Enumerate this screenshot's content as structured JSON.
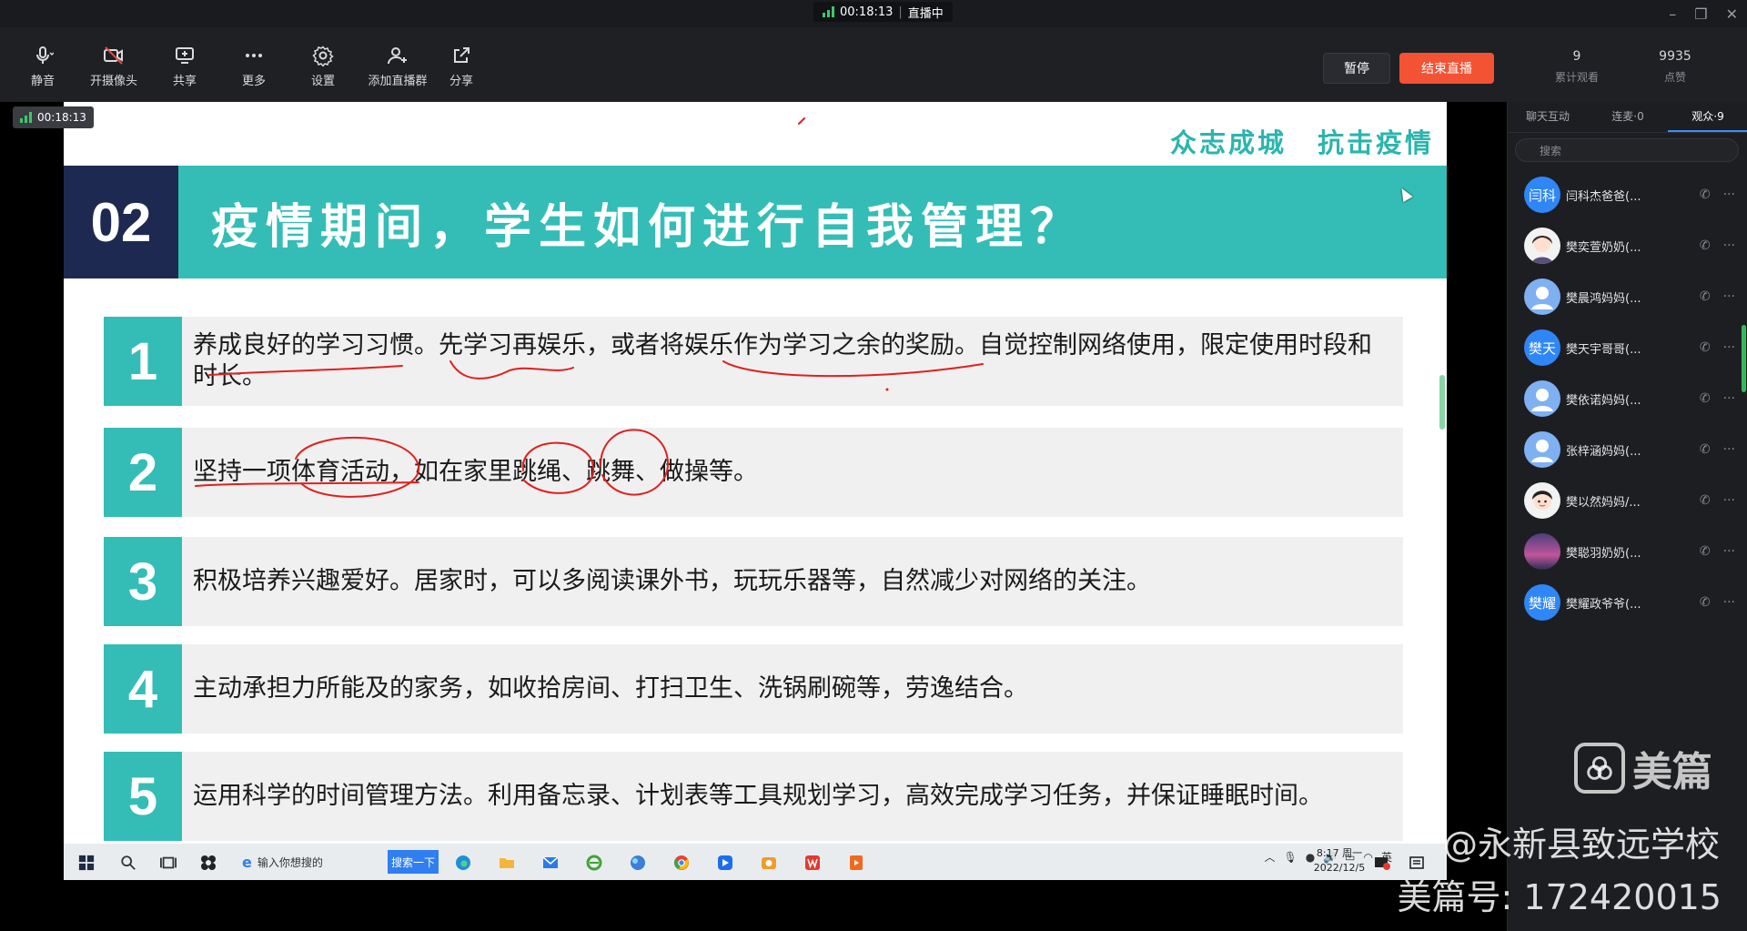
{
  "status": {
    "timer": "00:18:13",
    "live_label": "直播中"
  },
  "toolbar": {
    "mute": "静音",
    "camera": "开摄像头",
    "share": "共享",
    "more": "更多",
    "settings": "设置",
    "add_group": "添加直播群",
    "share_link": "分享",
    "pause": "暂停",
    "end_live": "结束直播",
    "cumulative_viewers": "9",
    "cumulative_viewers_label": "累计观看",
    "likes": "9935",
    "likes_label": "点赞"
  },
  "stage": {
    "timer": "00:18:13"
  },
  "slide": {
    "slogan_left": "众志成城",
    "slogan_right": "抗击疫情",
    "section_number": "02",
    "section_title": "疫情期间，学生如何进行自我管理？",
    "items": [
      {
        "n": "1",
        "text": "养成良好的学习习惯。先学习再娱乐，或者将娱乐作为学习之余的奖励。自觉控制网络使用，限定使用时段和时长。"
      },
      {
        "n": "2",
        "text": "坚持一项体育活动，如在家里跳绳、跳舞、做操等。"
      },
      {
        "n": "3",
        "text": "积极培养兴趣爱好。居家时，可以多阅读课外书，玩玩乐器等，自然减少对网络的关注。"
      },
      {
        "n": "4",
        "text": "主动承担力所能及的家务，如收拾房间、打扫卫生、洗锅刷碗等，劳逸结合。"
      },
      {
        "n": "5",
        "text": "运用科学的时间管理方法。利用备忘录、计划表等工具规划学习，高效完成学习任务，并保证睡眠时间。"
      }
    ]
  },
  "taskbar": {
    "search_placeholder": "输入你想搜的",
    "search_button": "搜索一下",
    "clock_time": "8:17 周一",
    "clock_date": "2022/12/5"
  },
  "panel": {
    "tabs": [
      "聊天互动",
      "连麦·0",
      "观众·9"
    ],
    "search_placeholder": "搜索",
    "users": [
      {
        "avatar": "闫科",
        "name": "闫科杰爸爸(...",
        "style": "blue"
      },
      {
        "avatar": "",
        "name": "樊奕萱奶奶(...",
        "style": "face"
      },
      {
        "avatar": "",
        "name": "樊晨鸿妈妈(...",
        "style": "light"
      },
      {
        "avatar": "樊天",
        "name": "樊天宇哥哥(...",
        "style": "blue"
      },
      {
        "avatar": "",
        "name": "樊依诺妈妈(...",
        "style": "light"
      },
      {
        "avatar": "",
        "name": "张梓涵妈妈(...",
        "style": "light"
      },
      {
        "avatar": "",
        "name": "樊以然妈妈/...",
        "style": "face"
      },
      {
        "avatar": "",
        "name": "樊聪羽奶奶(...",
        "style": "city"
      },
      {
        "avatar": "樊耀",
        "name": "樊耀政爷爷(...",
        "style": "blue"
      }
    ]
  },
  "watermark": {
    "brand": "美篇",
    "account": "@永新县致远学校",
    "id_line": "美篇号: 172420015"
  },
  "colors": {
    "teal": "#34bdb6",
    "navy": "#1d2951",
    "end_button": "#f35233",
    "ink": "#e0201e"
  }
}
